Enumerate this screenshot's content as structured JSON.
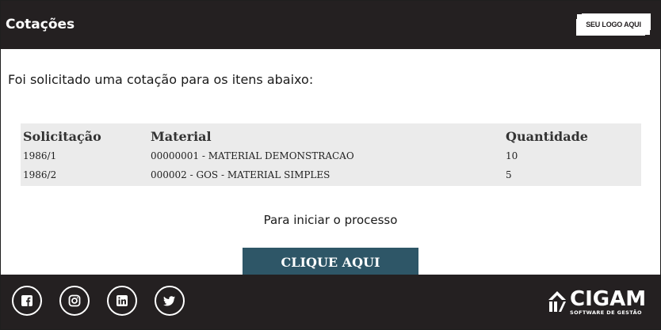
{
  "header": {
    "title": "Cotações",
    "logo_placeholder": "SEU LOGO AQUI"
  },
  "main": {
    "intro": "Foi solicitado uma cotação para os itens abaixo:",
    "table": {
      "headers": [
        "Solicitação",
        "Material",
        "Quantidade"
      ],
      "rows": [
        [
          "1986/1",
          "00000001 - MATERIAL DEMONSTRACAO",
          "10"
        ],
        [
          "1986/2",
          "000002 - GOS - MATERIAL SIMPLES",
          "5"
        ]
      ]
    },
    "cta_text": "Para iniciar o processo",
    "cta_button": "CLIQUE AQUI"
  },
  "footer": {
    "social_icons": [
      "facebook-icon",
      "instagram-icon",
      "linkedin-icon",
      "twitter-icon"
    ],
    "brand_name": "CIGAM",
    "brand_tagline": "SOFTWARE DE GESTÃO"
  },
  "colors": {
    "header_bg": "#242021",
    "button_bg": "#2e5667",
    "table_bg": "#ebebeb"
  }
}
